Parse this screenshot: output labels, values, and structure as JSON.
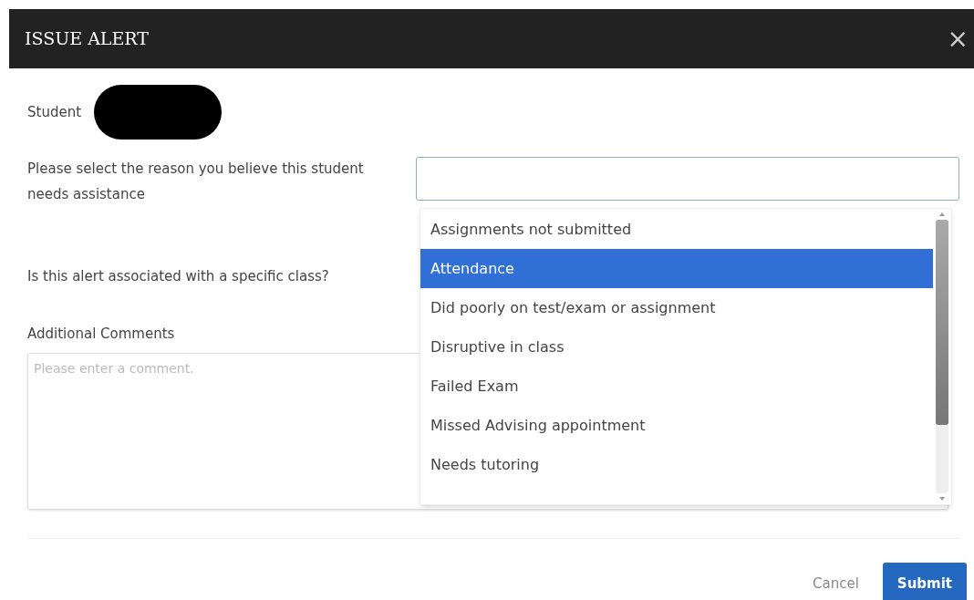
{
  "dialog": {
    "title": "ISSUE ALERT",
    "close": "×"
  },
  "student": {
    "label": "Student"
  },
  "reason": {
    "label": "Please select the reason you believe this student needs assistance",
    "options": [
      {
        "label": "Assignments not submitted",
        "selected": false
      },
      {
        "label": "Attendance",
        "selected": true
      },
      {
        "label": "Did poorly on test/exam or assignment",
        "selected": false
      },
      {
        "label": "Disruptive in class",
        "selected": false
      },
      {
        "label": "Failed Exam",
        "selected": false
      },
      {
        "label": "Missed Advising appointment",
        "selected": false
      },
      {
        "label": "Needs tutoring",
        "selected": false
      }
    ]
  },
  "class_question": {
    "label": "Is this alert associated with a specific class?"
  },
  "comments": {
    "label": "Additional Comments",
    "placeholder": "Please enter a comment."
  },
  "buttons": [
    {
      "label": "Cancel",
      "kind": "link"
    },
    {
      "label": "Submit",
      "kind": "primary"
    }
  ]
}
